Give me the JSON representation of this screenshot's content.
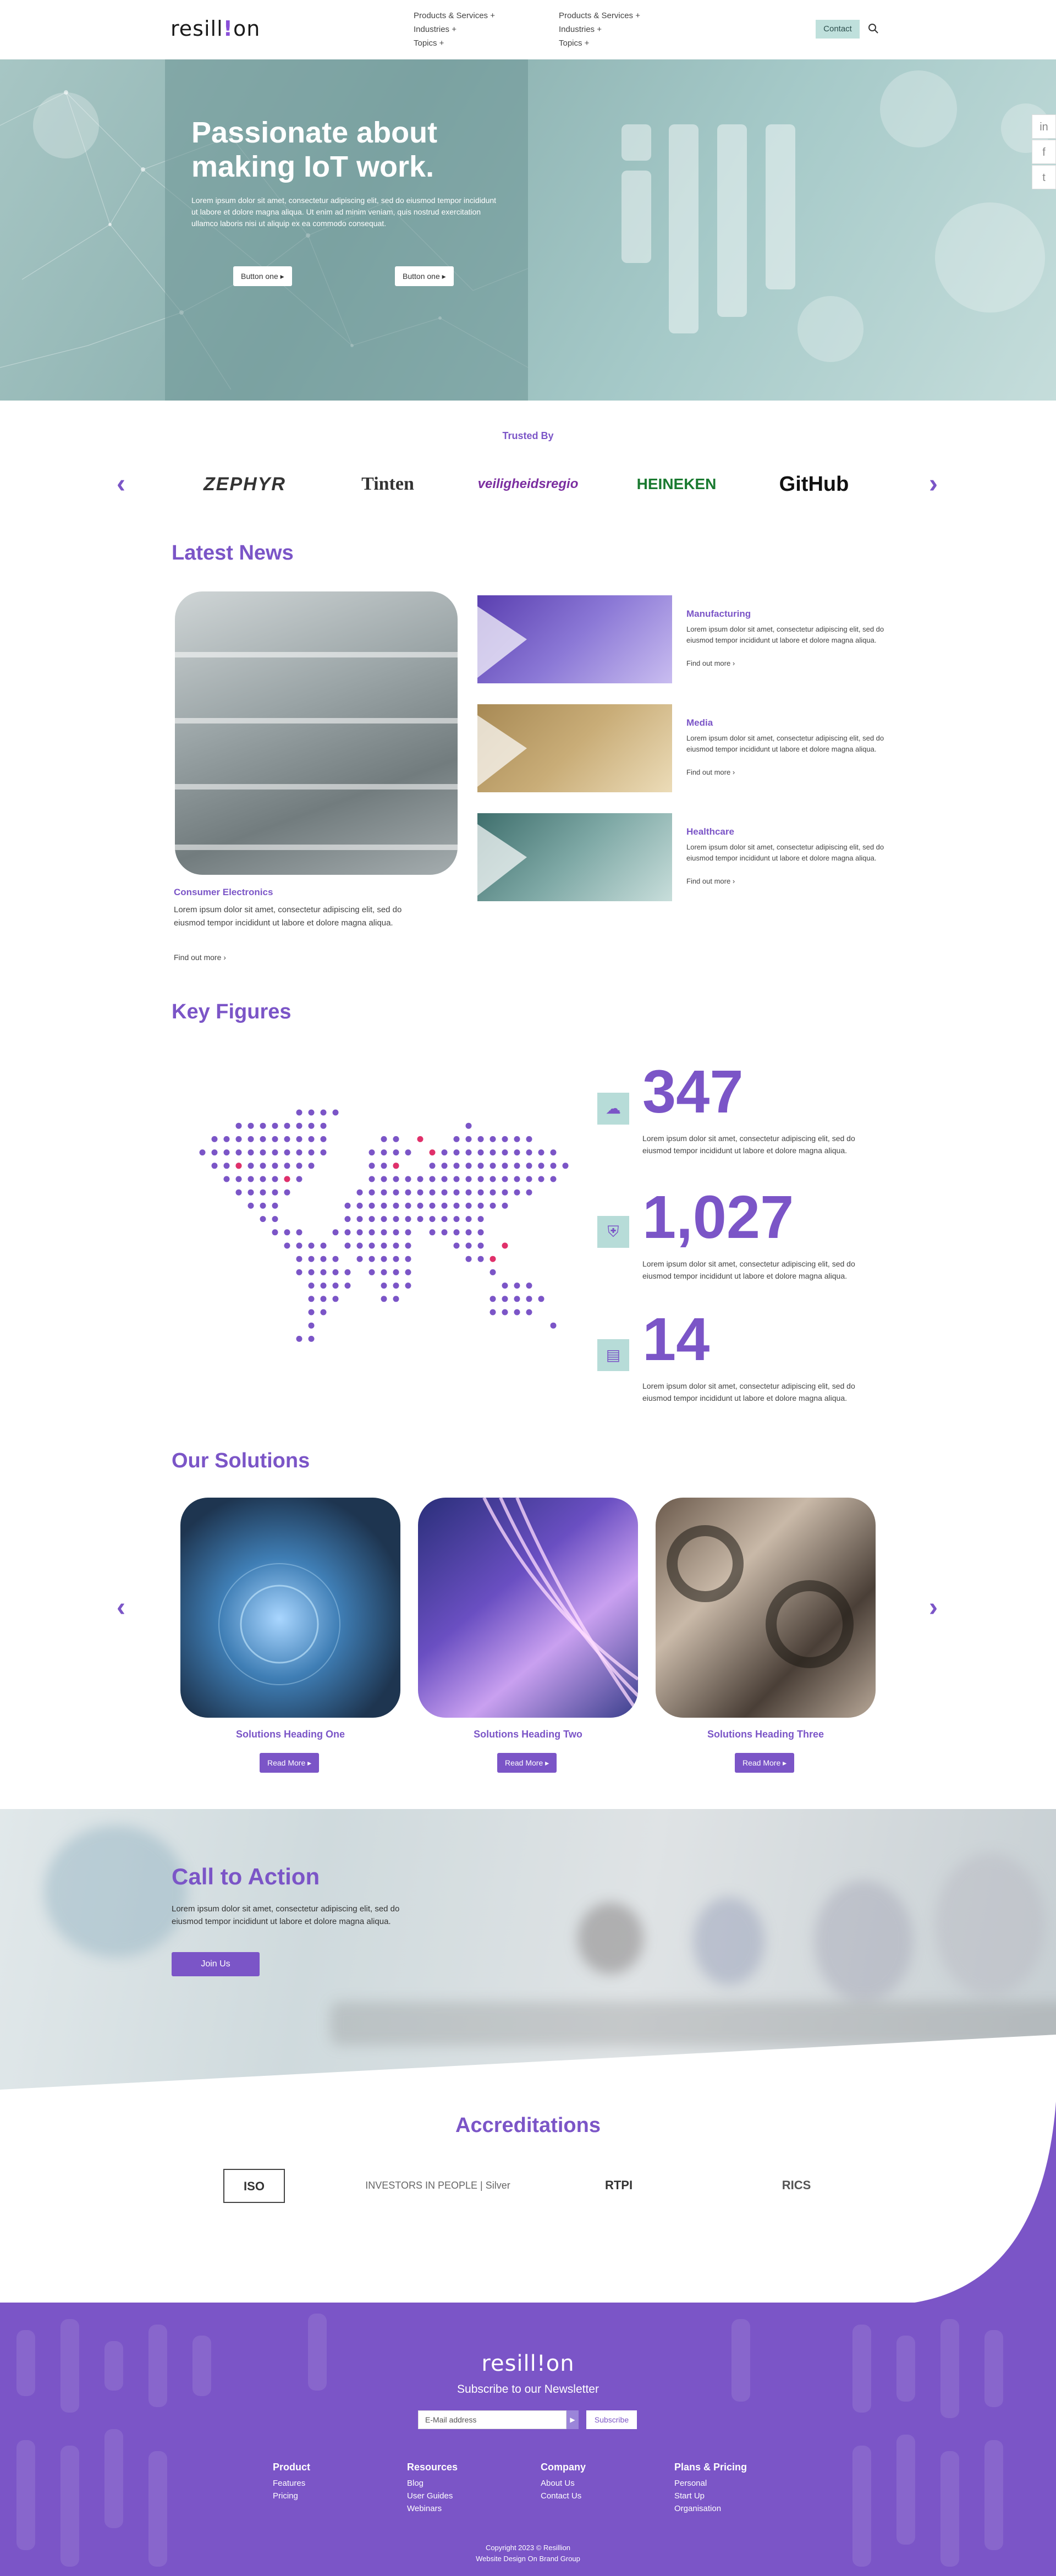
{
  "header": {
    "logo": "resill!on",
    "nav_col1": [
      "Products & Services +",
      "Industries +",
      "Topics +"
    ],
    "nav_col2": [
      "Products & Services +",
      "Industries +",
      "Topics +"
    ],
    "contact_label": "Contact"
  },
  "hero": {
    "title": "Passionate about making IoT work.",
    "text": "Lorem ipsum dolor sit amet, consectetur adipiscing elit, sed do eiusmod tempor incididunt ut labore et dolore magna aliqua. Ut enim ad minim veniam, quis nostrud exercitation ullamco laboris nisi ut aliquip ex ea commodo consequat.",
    "button1": "Button one ▸",
    "button2": "Button one ▸",
    "social": [
      "in",
      "f",
      "t"
    ]
  },
  "trusted": {
    "title": "Trusted By",
    "brands": [
      "ZEPHYR",
      "Tinten",
      "veiligheidsregio",
      "HEINEKEN",
      "GitHub"
    ]
  },
  "news": {
    "title": "Latest News",
    "featured": {
      "category": "Consumer Electronics",
      "text": "Lorem ipsum dolor sit amet, consectetur adipiscing elit, sed do eiusmod tempor incididunt ut labore et dolore magna aliqua.",
      "more": "Find out more ›"
    },
    "items": [
      {
        "category": "Manufacturing",
        "text": "Lorem ipsum dolor sit amet, consectetur adipiscing elit, sed do eiusmod tempor incididunt ut labore et dolore magna aliqua.",
        "more": "Find out more ›"
      },
      {
        "category": "Media",
        "text": "Lorem ipsum dolor sit amet, consectetur adipiscing elit, sed do eiusmod tempor incididunt ut labore et dolore magna aliqua.",
        "more": "Find out more ›"
      },
      {
        "category": "Healthcare",
        "text": "Lorem ipsum dolor sit amet, consectetur adipiscing elit, sed do eiusmod tempor incididunt ut labore et dolore magna aliqua.",
        "more": "Find out more ›"
      }
    ]
  },
  "figures": {
    "title": "Key Figures",
    "items": [
      {
        "value": "347",
        "icon": "network-icon",
        "text": "Lorem ipsum dolor sit amet, consectetur adipiscing elit, sed do eiusmod tempor incididunt ut labore et dolore magna aliqua."
      },
      {
        "value": "1,027",
        "icon": "shield-icon",
        "text": "Lorem ipsum dolor sit amet, consectetur adipiscing elit, sed do eiusmod tempor incididunt ut labore et dolore magna aliqua."
      },
      {
        "value": "14",
        "icon": "growth-chart-icon",
        "text": "Lorem ipsum dolor sit amet, consectetur adipiscing elit, sed do eiusmod tempor incididunt ut labore et dolore magna aliqua."
      }
    ]
  },
  "solutions": {
    "title": "Our Solutions",
    "items": [
      {
        "heading": "Solutions Heading One",
        "button": "Read More ▸"
      },
      {
        "heading": "Solutions Heading Two",
        "button": "Read More ▸"
      },
      {
        "heading": "Solutions Heading Three",
        "button": "Read More ▸"
      }
    ]
  },
  "cta": {
    "title": "Call to Action",
    "text": "Lorem ipsum dolor sit amet, consectetur adipiscing elit, sed do eiusmod tempor incididunt ut labore et dolore magna aliqua.",
    "button": "Join Us"
  },
  "accreditations": {
    "title": "Accreditations",
    "items": [
      "ISO",
      "INVESTORS IN PEOPLE | Silver",
      "RTPI",
      "RICS"
    ]
  },
  "footer": {
    "logo": "resill!on",
    "subscribe_title": "Subscribe to our Newsletter",
    "email_placeholder": "E-Mail address",
    "subscribe_button": "Subscribe",
    "columns": [
      {
        "heading": "Product",
        "links": [
          "Features",
          "Pricing"
        ]
      },
      {
        "heading": "Resources",
        "links": [
          "Blog",
          "User Guides",
          "Webinars"
        ]
      },
      {
        "heading": "Company",
        "links": [
          "About Us",
          "Contact Us"
        ]
      },
      {
        "heading": "Plans & Pricing",
        "links": [
          "Personal",
          "Start Up",
          "Organisation"
        ]
      }
    ],
    "copyright": "Copyright 2023 © Resillion",
    "credit": "Website Design On Brand Group"
  },
  "colors": {
    "accent": "#7b55c7",
    "teal": "#b7dcd8"
  }
}
